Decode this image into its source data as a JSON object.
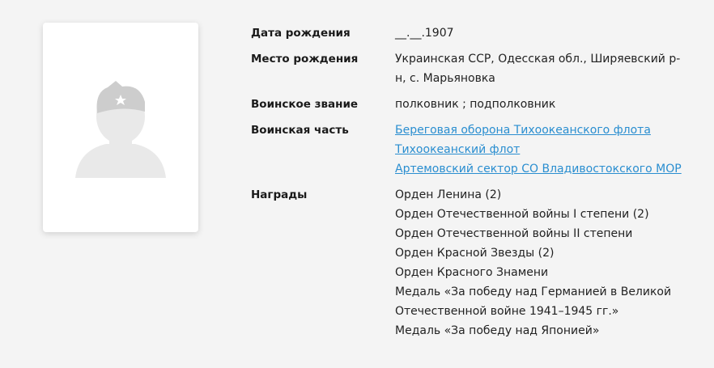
{
  "photo": {
    "icon": "soldier-silhouette-icon"
  },
  "fields": {
    "birth_date": {
      "label": "Дата рождения",
      "value": "__.__.1907"
    },
    "birth_place": {
      "label": "Место рождения",
      "value": "Украинская ССР, Одесская обл., Ширяевский р-н, с. Марьяновка"
    },
    "rank": {
      "label": "Воинское звание",
      "value": "полковник ; подполковник"
    },
    "unit": {
      "label": "Воинская часть",
      "links": [
        "Береговая оборона Тихоокеанского флота",
        "Тихоокеанский флот",
        "Артемовский сектор СО Владивостокского МОР"
      ]
    },
    "awards": {
      "label": "Награды",
      "items": [
        "Орден Ленина (2)",
        "Орден Отечественной войны I степени (2)",
        "Орден Отечественной войны II степени",
        "Орден Красной Звезды (2)",
        "Орден Красного Знамени",
        "Медаль «За победу над Германией в Великой",
        "Отечественной войне 1941–1945 гг.»",
        "Медаль «За победу над Японией»"
      ]
    }
  },
  "colors": {
    "background": "#f4f4f4",
    "link": "#2a8ed0",
    "silhouette": "#e8e8e8",
    "cap": "#cfcfcf"
  }
}
